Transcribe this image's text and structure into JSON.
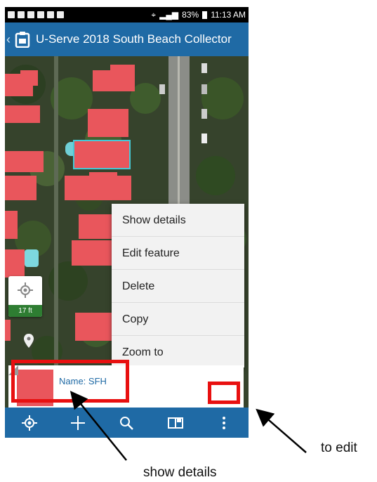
{
  "status_bar": {
    "battery": "83%",
    "time": "11:13 AM"
  },
  "title_bar": {
    "title": "U-Serve 2018 South Beach Collector",
    "back_icon": "chevron-left-icon",
    "app_icon": "collector-app-icon"
  },
  "map": {
    "scale_label": "17 ft",
    "locate_icon": "crosshair-icon",
    "pin_icon": "map-pin-icon",
    "feature_color": "#e9565c"
  },
  "context_menu": {
    "items": [
      "Show details",
      "Edit feature",
      "Delete",
      "Copy",
      "Zoom to"
    ]
  },
  "popup": {
    "name_label": "Name: SFH",
    "swatch_color": "#e9565c"
  },
  "bottom_bar": {
    "buttons": [
      "locate-icon",
      "add-icon",
      "search-icon",
      "map-book-icon",
      "more-vertical-icon"
    ]
  },
  "annotations": {
    "to_edit": "to edit",
    "show_details": "show details",
    "highlight_color": "#e81010"
  },
  "colors": {
    "primary": "#1f6aa5",
    "scale_green": "#2e7d32"
  }
}
